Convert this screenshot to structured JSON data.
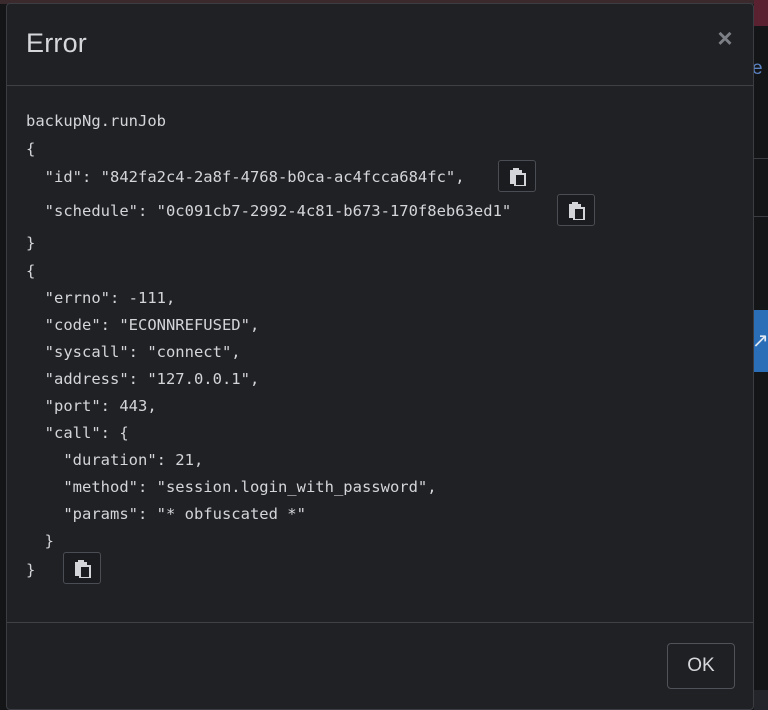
{
  "background": {
    "link_fragment": "e"
  },
  "modal": {
    "title": "Error",
    "close_glyph": "×",
    "ok_label": "OK"
  },
  "code": {
    "lines": [
      "backupNg.runJob",
      "{",
      "  \"id\": \"842fa2c4-2a8f-4768-b0ca-ac4fcca684fc\",",
      "  \"schedule\": \"0c091cb7-2992-4c81-b673-170f8eb63ed1\"",
      "}",
      "{",
      "  \"errno\": -111,",
      "  \"code\": \"ECONNREFUSED\",",
      "  \"syscall\": \"connect\",",
      "  \"address\": \"127.0.0.1\",",
      "  \"port\": 443,",
      "  \"call\": {",
      "    \"duration\": 21,",
      "    \"method\": \"session.login_with_password\",",
      "    \"params\": \"* obfuscated *\"",
      "  }",
      "}"
    ]
  },
  "icons": {
    "copy": "clipboard-icon",
    "close": "close-icon"
  },
  "colors": {
    "modal_bg": "#202124",
    "text": "#d4d5d8",
    "border": "#3f4147",
    "link": "#5b83c2"
  }
}
